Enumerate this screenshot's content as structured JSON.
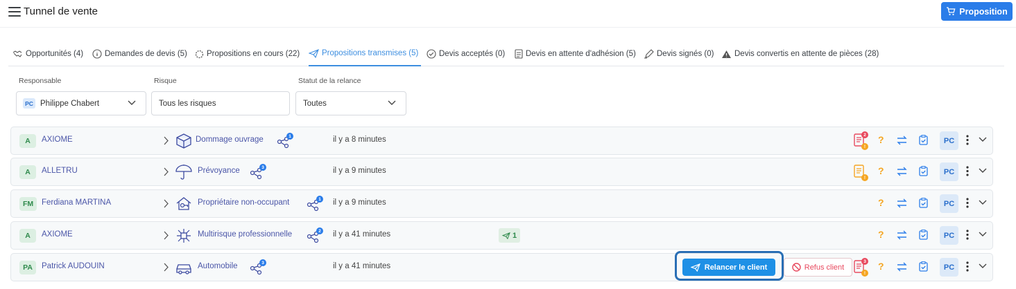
{
  "header": {
    "title": "Tunnel de vente",
    "proposition_button": "Proposition"
  },
  "tabs": [
    {
      "label": "Opportunités (4)"
    },
    {
      "label": "Demandes de devis (5)"
    },
    {
      "label": "Propositions en cours (22)"
    },
    {
      "label": "Propositions transmises (5)",
      "active": true
    },
    {
      "label": "Devis acceptés (0)"
    },
    {
      "label": "Devis en attente d'adhésion (5)"
    },
    {
      "label": "Devis signés (0)"
    },
    {
      "label": "Devis convertis en attente de pièces (28)"
    }
  ],
  "filters": {
    "responsable": {
      "label": "Responsable",
      "initials": "PC",
      "value": "Philippe Chabert"
    },
    "risque": {
      "label": "Risque",
      "value": "Tous les risques"
    },
    "statut": {
      "label": "Statut de la relance",
      "value": "Toutes"
    }
  },
  "rows": [
    {
      "initials": "A",
      "name": "AXIOME",
      "risk": "Dommage ouvrage",
      "risk_icon": "box-icon",
      "share_count": "1",
      "time": "il y a 8 minutes",
      "doc_badge_red": "2",
      "doc_badge_orange": "!",
      "doc_color": "#e84a5f",
      "user": "PC"
    },
    {
      "initials": "A",
      "name": "ALLETRU",
      "risk": "Prévoyance",
      "risk_icon": "umbrella-icon",
      "share_count": "3",
      "time": "il y a 9 minutes",
      "doc_badge_orange": "!",
      "doc_color": "#f5a623",
      "user": "PC"
    },
    {
      "initials": "FM",
      "name": "Ferdiana MARTINA",
      "risk": "Propriétaire non-occupant",
      "risk_icon": "house-key-icon",
      "share_count": "1",
      "time": "il y a 9 minutes",
      "user": "PC"
    },
    {
      "initials": "A",
      "name": "AXIOME",
      "risk": "Multirisque professionnelle",
      "risk_icon": "network-icon",
      "share_count": "2",
      "time": "il y a 41 minutes",
      "sent_count": "1",
      "user": "PC"
    },
    {
      "initials": "PA",
      "name": "Patrick AUDOUIN",
      "risk": "Automobile",
      "risk_icon": "car-icon",
      "share_count": "3",
      "time": "il y a 41 minutes",
      "relancer_label": "Relancer le client",
      "refus_label": "Refus client",
      "doc_badge_red": "3",
      "doc_badge_orange": "!",
      "doc_color": "#e84a5f",
      "user": "PC"
    }
  ],
  "row_actions": {
    "question": "?"
  }
}
